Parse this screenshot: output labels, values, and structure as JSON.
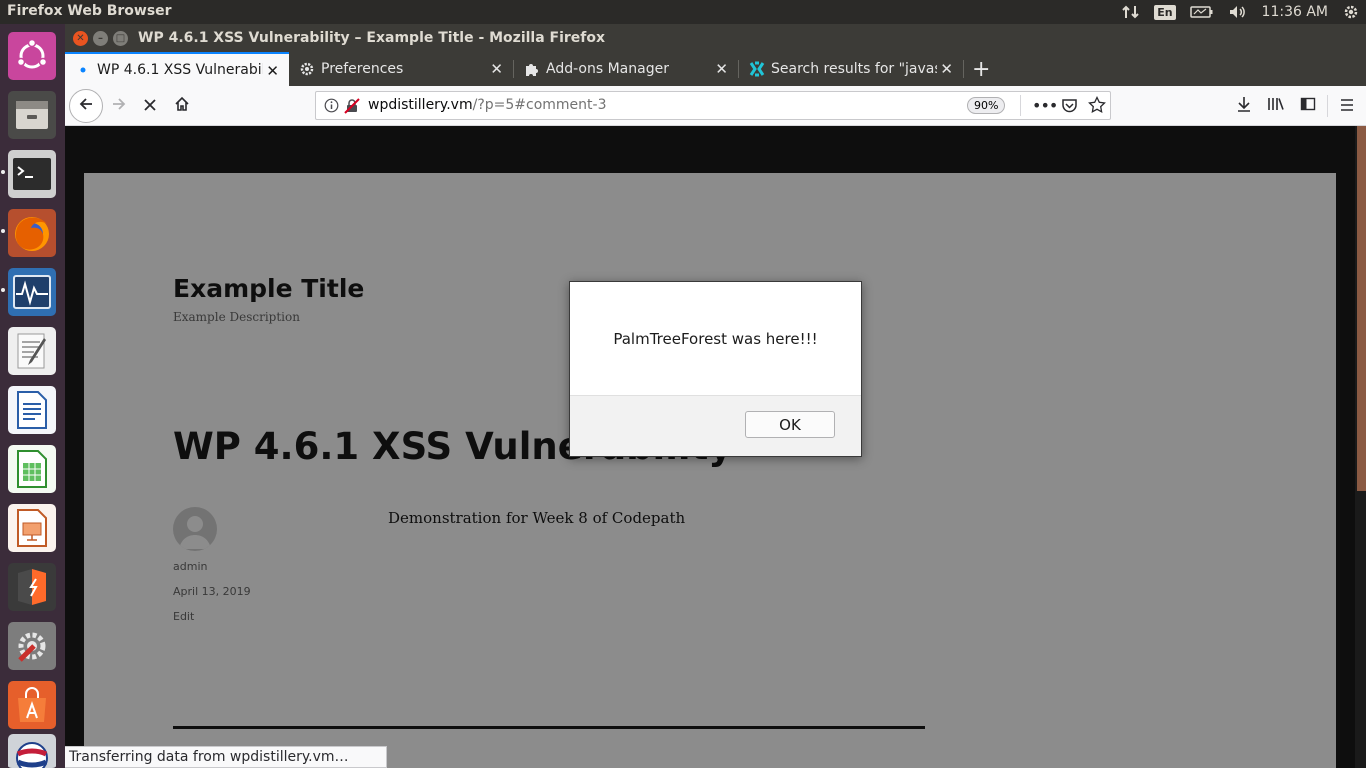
{
  "top_panel": {
    "app_name": "Firefox Web Browser",
    "language": "En",
    "clock": "11:36 AM"
  },
  "launcher": {
    "items": [
      {
        "name": "ubuntu-dash-icon"
      },
      {
        "name": "files-icon"
      },
      {
        "name": "terminal-icon"
      },
      {
        "name": "firefox-icon"
      },
      {
        "name": "system-monitor-icon"
      },
      {
        "name": "text-editor-icon"
      },
      {
        "name": "writer-icon"
      },
      {
        "name": "calc-icon"
      },
      {
        "name": "impress-icon"
      },
      {
        "name": "sublime-icon"
      },
      {
        "name": "settings-icon"
      },
      {
        "name": "software-center-icon"
      },
      {
        "name": "pepsi-icon"
      }
    ]
  },
  "window": {
    "title": "WP 4.6.1 XSS Vulnerability – Example Title - Mozilla Firefox"
  },
  "tabs": [
    {
      "label": "WP 4.6.1 XSS Vulnerabili",
      "active": true
    },
    {
      "label": "Preferences",
      "active": false
    },
    {
      "label": "Add-ons Manager",
      "active": false
    },
    {
      "label": "Search results for \"javas",
      "active": false
    }
  ],
  "navbar": {
    "url_host": "wpdistillery.vm",
    "url_path": "/?p=5#comment-3",
    "zoom": "90%"
  },
  "page": {
    "site_title": "Example Title",
    "site_description": "Example Description",
    "post_title": "WP 4.6.1 XSS Vulnerability",
    "author": "admin",
    "date": "April 13, 2019",
    "edit": "Edit",
    "body": "Demonstration for Week 8 of Codepath"
  },
  "dialog": {
    "message": "PalmTreeForest was here!!!",
    "ok_label": "OK"
  },
  "statusbar": {
    "text": "Transferring data from wpdistillery.vm…"
  }
}
